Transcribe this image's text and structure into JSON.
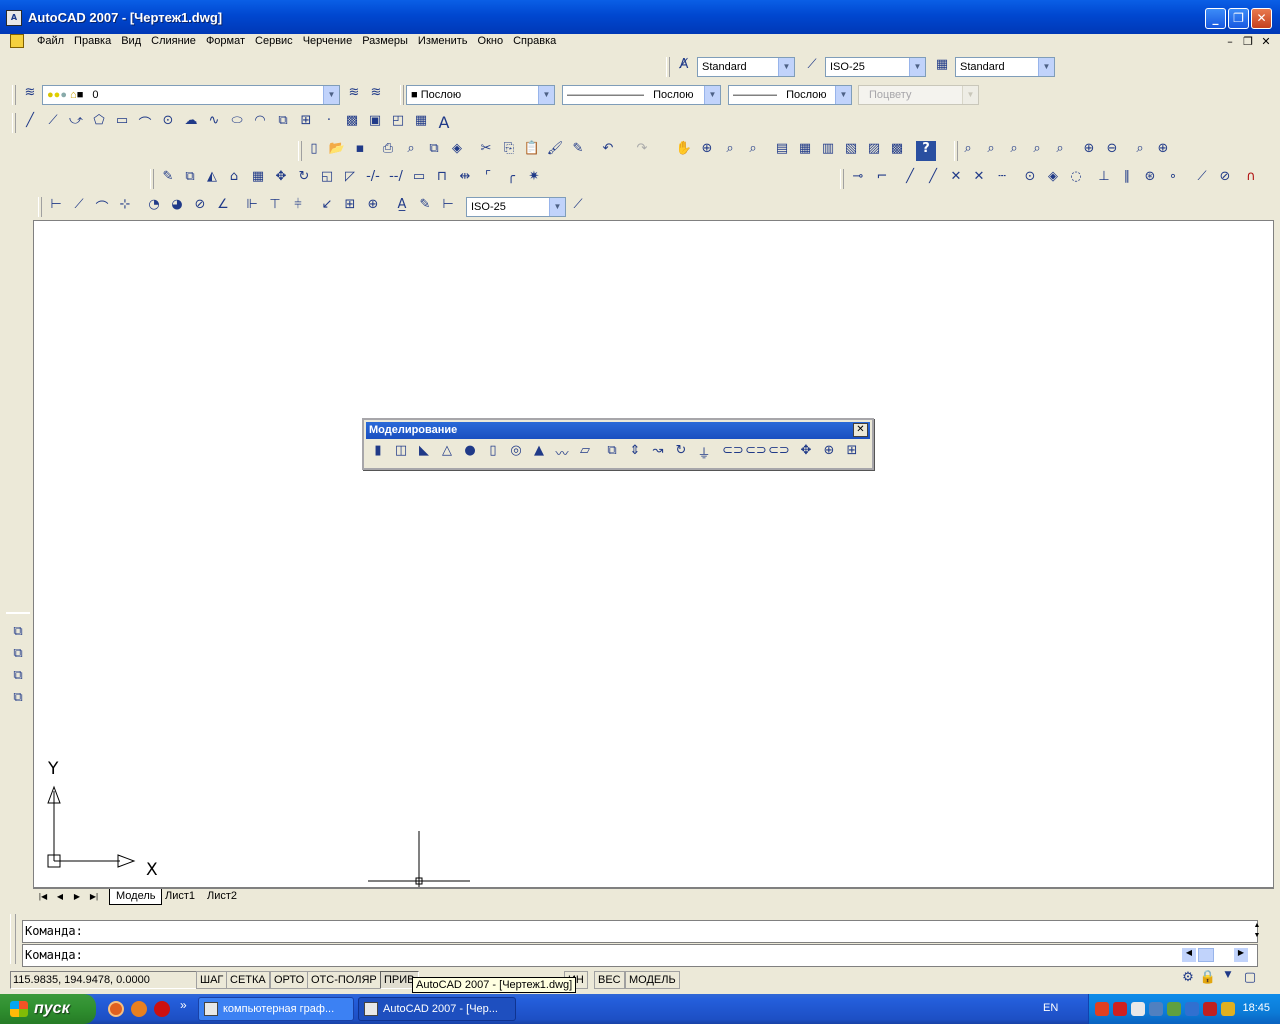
{
  "window": {
    "title": "AutoCAD 2007 - [Чертеж1.dwg]",
    "icon": "autocad-icon"
  },
  "menu": [
    "Файл",
    "Правка",
    "Вид",
    "Слияние",
    "Формат",
    "Сервис",
    "Черчение",
    "Размеры",
    "Изменить",
    "Окно",
    "Справка"
  ],
  "styles_toolbar": {
    "text_style": "Standard",
    "dim_style": "ISO-25",
    "table_style": "Standard"
  },
  "layers_toolbar": {
    "current_layer": "0"
  },
  "properties_toolbar": {
    "color": "Послою",
    "linetype": "Послою",
    "lineweight": "Послою",
    "plotstyle": "Поцвету"
  },
  "dim_toolbar": {
    "dim_style": "ISO-25"
  },
  "float_toolbar": {
    "title": "Моделирование",
    "close_glyph": "✕"
  },
  "ucs": {
    "x_label": "X",
    "y_label": "Y"
  },
  "layout_tabs": [
    "Модель",
    "Лист1",
    "Лист2"
  ],
  "command": {
    "prompt1": "Команда:",
    "prompt2": "Команда:"
  },
  "status": {
    "coordinates": "115.9835, 194.9478, 0.0000",
    "buttons": [
      "ШАГ",
      "СЕТКА",
      "ОРТО",
      "ОТС-ПОЛЯР",
      "ПРИВ",
      "ИН",
      "ВЕС",
      "МОДЕЛЬ"
    ],
    "tooltip": "AutoCAD 2007 - [Чертеж1.dwg]"
  },
  "taskbar": {
    "start_label": "пуск",
    "chevron": "»",
    "tasks": [
      {
        "label": "компьютерная граф...",
        "icon": "word-icon"
      },
      {
        "label": "AutoCAD 2007 - [Чер...",
        "icon": "autocad-icon"
      }
    ],
    "language": "EN",
    "clock": "18:45"
  }
}
